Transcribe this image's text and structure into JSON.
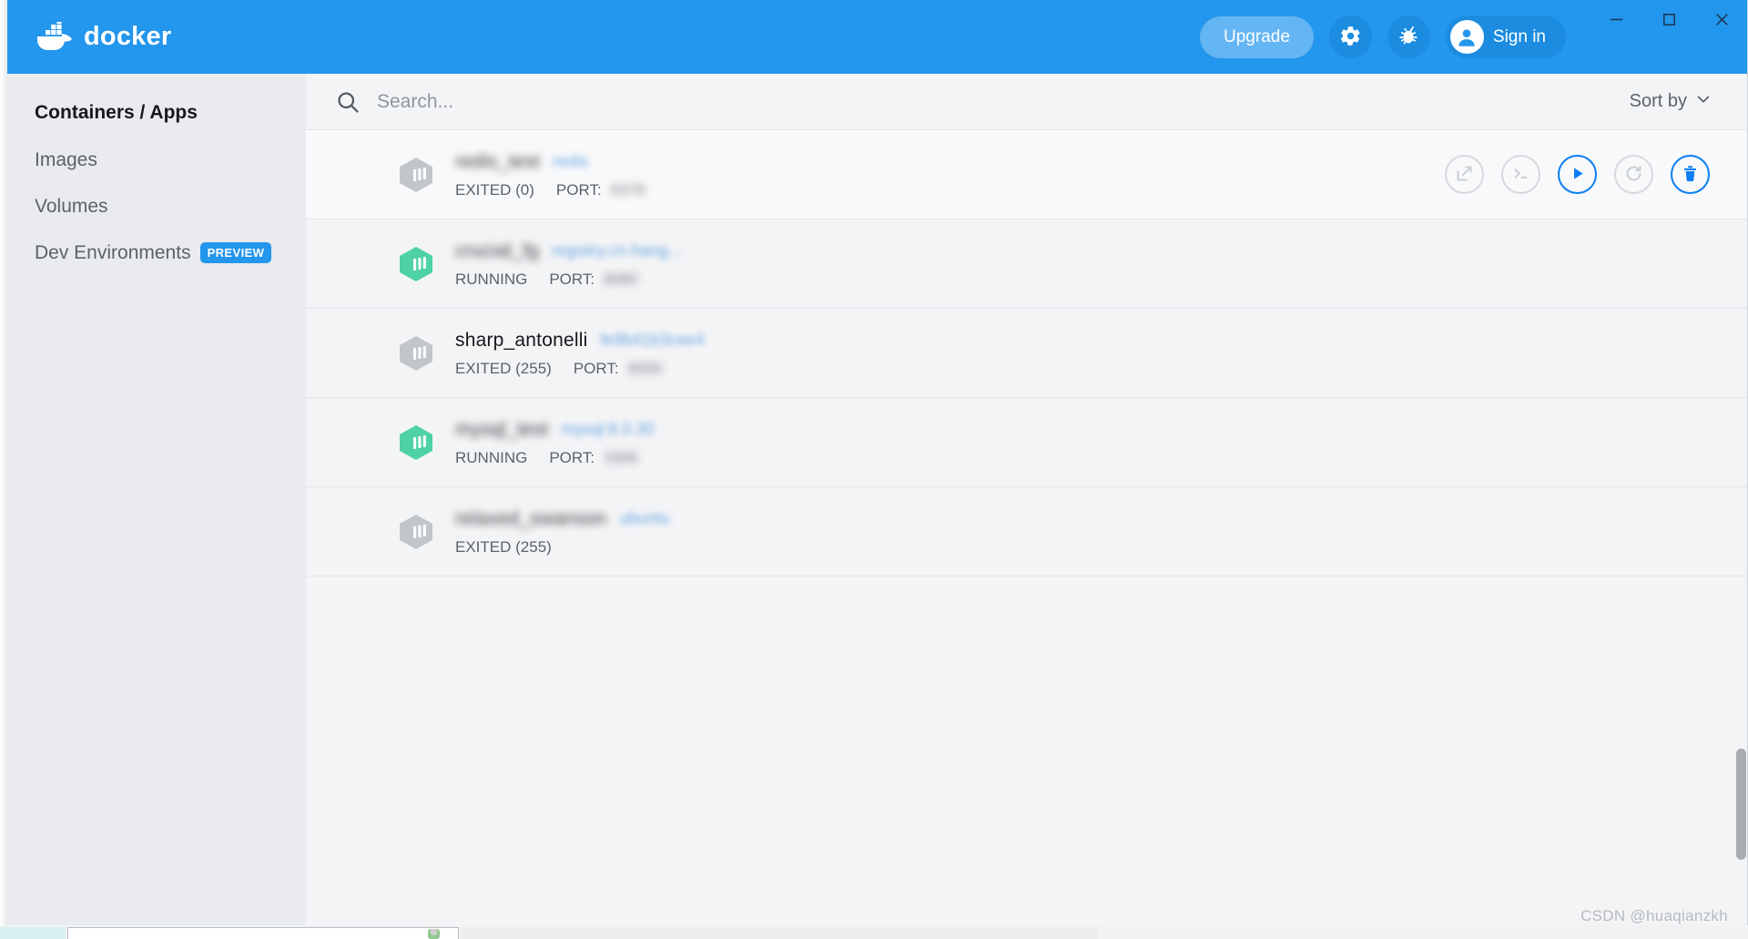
{
  "window": {
    "app_title": "docker",
    "minimize_label": "—",
    "maximize_label": "□",
    "close_label": "✕"
  },
  "titlebar": {
    "upgrade_label": "Upgrade",
    "settings_icon": "gear-icon",
    "troubleshoot_icon": "bug-icon",
    "signin_label": "Sign in",
    "signin_icon": "user-avatar-icon",
    "brand_color": "#2396ed",
    "upgrade_bg": "#64b5f3"
  },
  "sidebar": {
    "items": [
      {
        "label": "Containers / Apps",
        "active": true,
        "badge": ""
      },
      {
        "label": "Images",
        "active": false,
        "badge": ""
      },
      {
        "label": "Volumes",
        "active": false,
        "badge": ""
      },
      {
        "label": "Dev Environments",
        "active": false,
        "badge": "PREVIEW"
      }
    ],
    "badge_color": "#2396ed"
  },
  "toolbar": {
    "search_placeholder": "Search...",
    "search_value": "",
    "search_icon": "search-icon",
    "sort_label": "Sort by",
    "sort_caret": "chevron-down-icon"
  },
  "containers": [
    {
      "name": "redis_test",
      "name_redacted": true,
      "image": "redis",
      "image_redacted": true,
      "status": "EXITED (0)",
      "running": false,
      "port_label": "PORT:",
      "port_value": "6379",
      "port_redacted": true,
      "hovered": true,
      "actions_visible": true
    },
    {
      "name": "crucial_fg",
      "name_redacted": true,
      "image": "registry.cn-hang...",
      "image_redacted": true,
      "status": "RUNNING",
      "running": true,
      "port_label": "PORT:",
      "port_value": "8080",
      "port_redacted": true,
      "hovered": false,
      "actions_visible": false
    },
    {
      "name": "sharp_antonelli",
      "name_redacted": false,
      "image": "fe9b41b3cee4",
      "image_redacted": true,
      "status": "EXITED (255)",
      "running": false,
      "port_label": "PORT:",
      "port_value": "8000",
      "port_redacted": true,
      "hovered": false,
      "actions_visible": false
    },
    {
      "name": "mysql_test",
      "name_redacted": true,
      "image": "mysql:8.0.30",
      "image_redacted": true,
      "status": "RUNNING",
      "running": true,
      "port_label": "PORT:",
      "port_value": "3306",
      "port_redacted": true,
      "hovered": false,
      "actions_visible": false
    },
    {
      "name": "relaxed_swanson",
      "name_redacted": true,
      "image": "ubuntu",
      "image_redacted": true,
      "status": "EXITED (255)",
      "running": false,
      "port_label": "",
      "port_value": "",
      "port_redacted": false,
      "hovered": false,
      "actions_visible": false
    }
  ],
  "row_actions": [
    {
      "name": "open-in-browser",
      "enabled": false
    },
    {
      "name": "open-cli",
      "enabled": false
    },
    {
      "name": "start",
      "enabled": true
    },
    {
      "name": "restart",
      "enabled": false
    },
    {
      "name": "delete",
      "enabled": true
    }
  ],
  "colors": {
    "running_cube": "#4fd1a6",
    "stopped_cube": "#c2c6ca",
    "accent_blue": "#0b7ef4",
    "image_link": "#5b9de0"
  },
  "watermark": {
    "text": "CSDN @huaqianzkh"
  }
}
